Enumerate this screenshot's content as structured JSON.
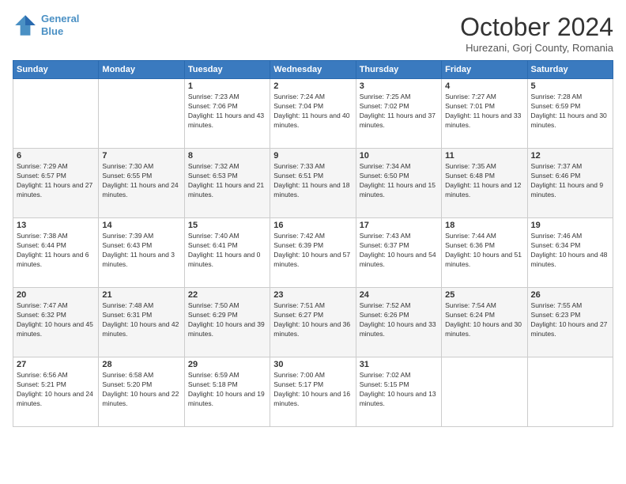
{
  "header": {
    "logo_line1": "General",
    "logo_line2": "Blue",
    "month": "October 2024",
    "location": "Hurezani, Gorj County, Romania"
  },
  "weekdays": [
    "Sunday",
    "Monday",
    "Tuesday",
    "Wednesday",
    "Thursday",
    "Friday",
    "Saturday"
  ],
  "weeks": [
    [
      {
        "day": "",
        "info": ""
      },
      {
        "day": "",
        "info": ""
      },
      {
        "day": "1",
        "info": "Sunrise: 7:23 AM\nSunset: 7:06 PM\nDaylight: 11 hours and 43 minutes."
      },
      {
        "day": "2",
        "info": "Sunrise: 7:24 AM\nSunset: 7:04 PM\nDaylight: 11 hours and 40 minutes."
      },
      {
        "day": "3",
        "info": "Sunrise: 7:25 AM\nSunset: 7:02 PM\nDaylight: 11 hours and 37 minutes."
      },
      {
        "day": "4",
        "info": "Sunrise: 7:27 AM\nSunset: 7:01 PM\nDaylight: 11 hours and 33 minutes."
      },
      {
        "day": "5",
        "info": "Sunrise: 7:28 AM\nSunset: 6:59 PM\nDaylight: 11 hours and 30 minutes."
      }
    ],
    [
      {
        "day": "6",
        "info": "Sunrise: 7:29 AM\nSunset: 6:57 PM\nDaylight: 11 hours and 27 minutes."
      },
      {
        "day": "7",
        "info": "Sunrise: 7:30 AM\nSunset: 6:55 PM\nDaylight: 11 hours and 24 minutes."
      },
      {
        "day": "8",
        "info": "Sunrise: 7:32 AM\nSunset: 6:53 PM\nDaylight: 11 hours and 21 minutes."
      },
      {
        "day": "9",
        "info": "Sunrise: 7:33 AM\nSunset: 6:51 PM\nDaylight: 11 hours and 18 minutes."
      },
      {
        "day": "10",
        "info": "Sunrise: 7:34 AM\nSunset: 6:50 PM\nDaylight: 11 hours and 15 minutes."
      },
      {
        "day": "11",
        "info": "Sunrise: 7:35 AM\nSunset: 6:48 PM\nDaylight: 11 hours and 12 minutes."
      },
      {
        "day": "12",
        "info": "Sunrise: 7:37 AM\nSunset: 6:46 PM\nDaylight: 11 hours and 9 minutes."
      }
    ],
    [
      {
        "day": "13",
        "info": "Sunrise: 7:38 AM\nSunset: 6:44 PM\nDaylight: 11 hours and 6 minutes."
      },
      {
        "day": "14",
        "info": "Sunrise: 7:39 AM\nSunset: 6:43 PM\nDaylight: 11 hours and 3 minutes."
      },
      {
        "day": "15",
        "info": "Sunrise: 7:40 AM\nSunset: 6:41 PM\nDaylight: 11 hours and 0 minutes."
      },
      {
        "day": "16",
        "info": "Sunrise: 7:42 AM\nSunset: 6:39 PM\nDaylight: 10 hours and 57 minutes."
      },
      {
        "day": "17",
        "info": "Sunrise: 7:43 AM\nSunset: 6:37 PM\nDaylight: 10 hours and 54 minutes."
      },
      {
        "day": "18",
        "info": "Sunrise: 7:44 AM\nSunset: 6:36 PM\nDaylight: 10 hours and 51 minutes."
      },
      {
        "day": "19",
        "info": "Sunrise: 7:46 AM\nSunset: 6:34 PM\nDaylight: 10 hours and 48 minutes."
      }
    ],
    [
      {
        "day": "20",
        "info": "Sunrise: 7:47 AM\nSunset: 6:32 PM\nDaylight: 10 hours and 45 minutes."
      },
      {
        "day": "21",
        "info": "Sunrise: 7:48 AM\nSunset: 6:31 PM\nDaylight: 10 hours and 42 minutes."
      },
      {
        "day": "22",
        "info": "Sunrise: 7:50 AM\nSunset: 6:29 PM\nDaylight: 10 hours and 39 minutes."
      },
      {
        "day": "23",
        "info": "Sunrise: 7:51 AM\nSunset: 6:27 PM\nDaylight: 10 hours and 36 minutes."
      },
      {
        "day": "24",
        "info": "Sunrise: 7:52 AM\nSunset: 6:26 PM\nDaylight: 10 hours and 33 minutes."
      },
      {
        "day": "25",
        "info": "Sunrise: 7:54 AM\nSunset: 6:24 PM\nDaylight: 10 hours and 30 minutes."
      },
      {
        "day": "26",
        "info": "Sunrise: 7:55 AM\nSunset: 6:23 PM\nDaylight: 10 hours and 27 minutes."
      }
    ],
    [
      {
        "day": "27",
        "info": "Sunrise: 6:56 AM\nSunset: 5:21 PM\nDaylight: 10 hours and 24 minutes."
      },
      {
        "day": "28",
        "info": "Sunrise: 6:58 AM\nSunset: 5:20 PM\nDaylight: 10 hours and 22 minutes."
      },
      {
        "day": "29",
        "info": "Sunrise: 6:59 AM\nSunset: 5:18 PM\nDaylight: 10 hours and 19 minutes."
      },
      {
        "day": "30",
        "info": "Sunrise: 7:00 AM\nSunset: 5:17 PM\nDaylight: 10 hours and 16 minutes."
      },
      {
        "day": "31",
        "info": "Sunrise: 7:02 AM\nSunset: 5:15 PM\nDaylight: 10 hours and 13 minutes."
      },
      {
        "day": "",
        "info": ""
      },
      {
        "day": "",
        "info": ""
      }
    ]
  ]
}
